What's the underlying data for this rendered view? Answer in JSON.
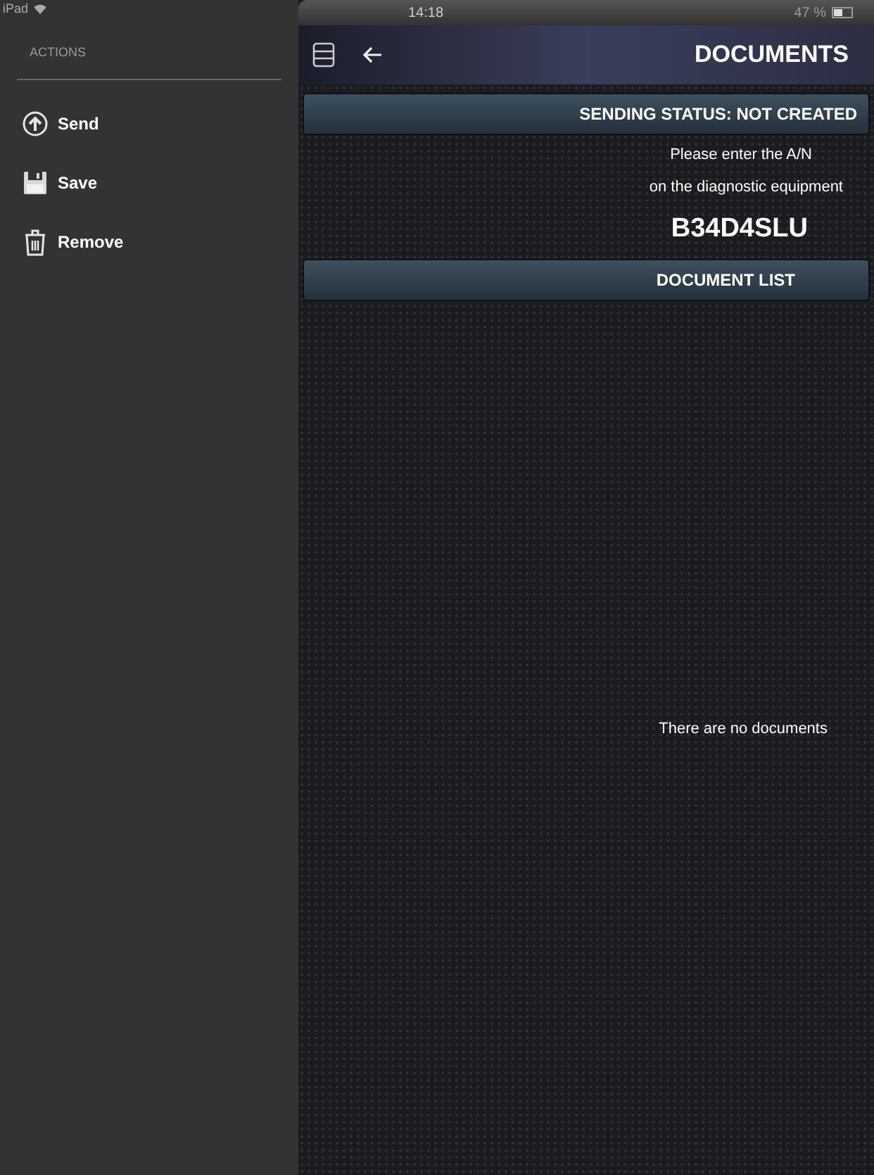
{
  "status_bar": {
    "device": "iPad",
    "time": "14:18",
    "battery": "47 %"
  },
  "sidebar": {
    "title": "ACTIONS",
    "items": [
      {
        "label": "Send",
        "kind": "send"
      },
      {
        "label": "Save",
        "kind": "save"
      },
      {
        "label": "Remove",
        "kind": "remove"
      }
    ]
  },
  "header": {
    "title": "DOCUMENTS"
  },
  "sending_status": "SENDING STATUS: NOT CREATED",
  "instructions": [
    "Please enter the A/N",
    "on the diagnostic equipment"
  ],
  "code": "B34D4SLU",
  "document_list": {
    "title": "DOCUMENT LIST",
    "empty_text": "There are no documents"
  }
}
